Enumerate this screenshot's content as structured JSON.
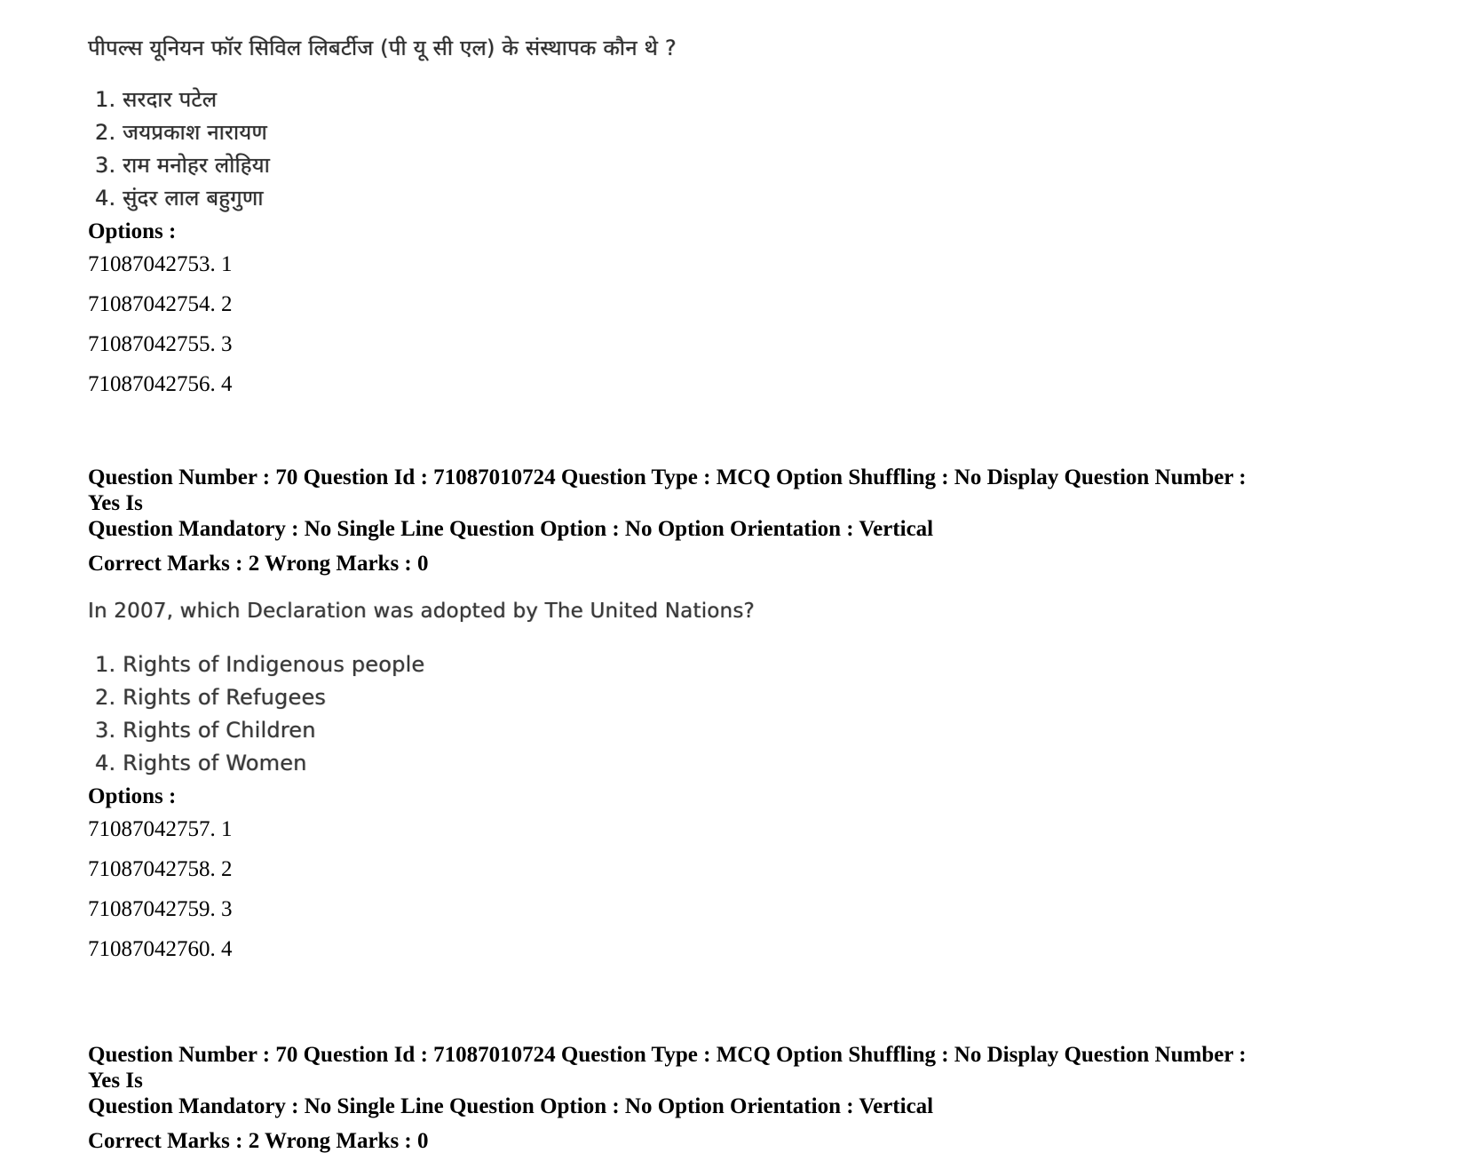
{
  "page": {
    "background_color": "#ffffff",
    "text_color": "#000000",
    "scan_text_color": "#3c3c3c"
  },
  "question_69": {
    "question_text_hindi": "पीपल्स यूनियन फॉर सिविल लिबर्टीज (पी यू सी एल) के संस्थापक कौन थे ?",
    "choices": [
      "1. सरदार पटेल",
      "2. जयप्रकाश नारायण",
      "3. राम मनोहर लोहिया",
      "4. सुंदर लाल बहुगुणा"
    ],
    "options_label": "Options :",
    "option_rows": [
      "71087042753. 1",
      "71087042754. 2",
      "71087042755. 3",
      "71087042756. 4"
    ]
  },
  "metadata_block_1": {
    "line1": "Question Number : 70 Question Id : 71087010724 Question Type : MCQ Option Shuffling : No Display Question Number : Yes Is",
    "line2": "Question Mandatory : No Single Line Question Option : No Option Orientation : Vertical",
    "marks_line": "Correct Marks : 2 Wrong Marks : 0"
  },
  "question_70": {
    "question_text_english": "In 2007, which Declaration was adopted by The United Nations?",
    "choices": [
      "1. Rights of Indigenous people",
      "2. Rights of Refugees",
      "3. Rights of Children",
      "4. Rights of Women"
    ],
    "options_label": "Options :",
    "option_rows": [
      "71087042757. 1",
      "71087042758. 2",
      "71087042759. 3",
      "71087042760. 4"
    ]
  },
  "metadata_block_2": {
    "line1": "Question Number : 70 Question Id : 71087010724 Question Type : MCQ Option Shuffling : No Display Question Number : Yes Is",
    "line2": "Question Mandatory : No Single Line Question Option : No Option Orientation : Vertical",
    "marks_line": "Correct Marks : 2 Wrong Marks : 0"
  }
}
